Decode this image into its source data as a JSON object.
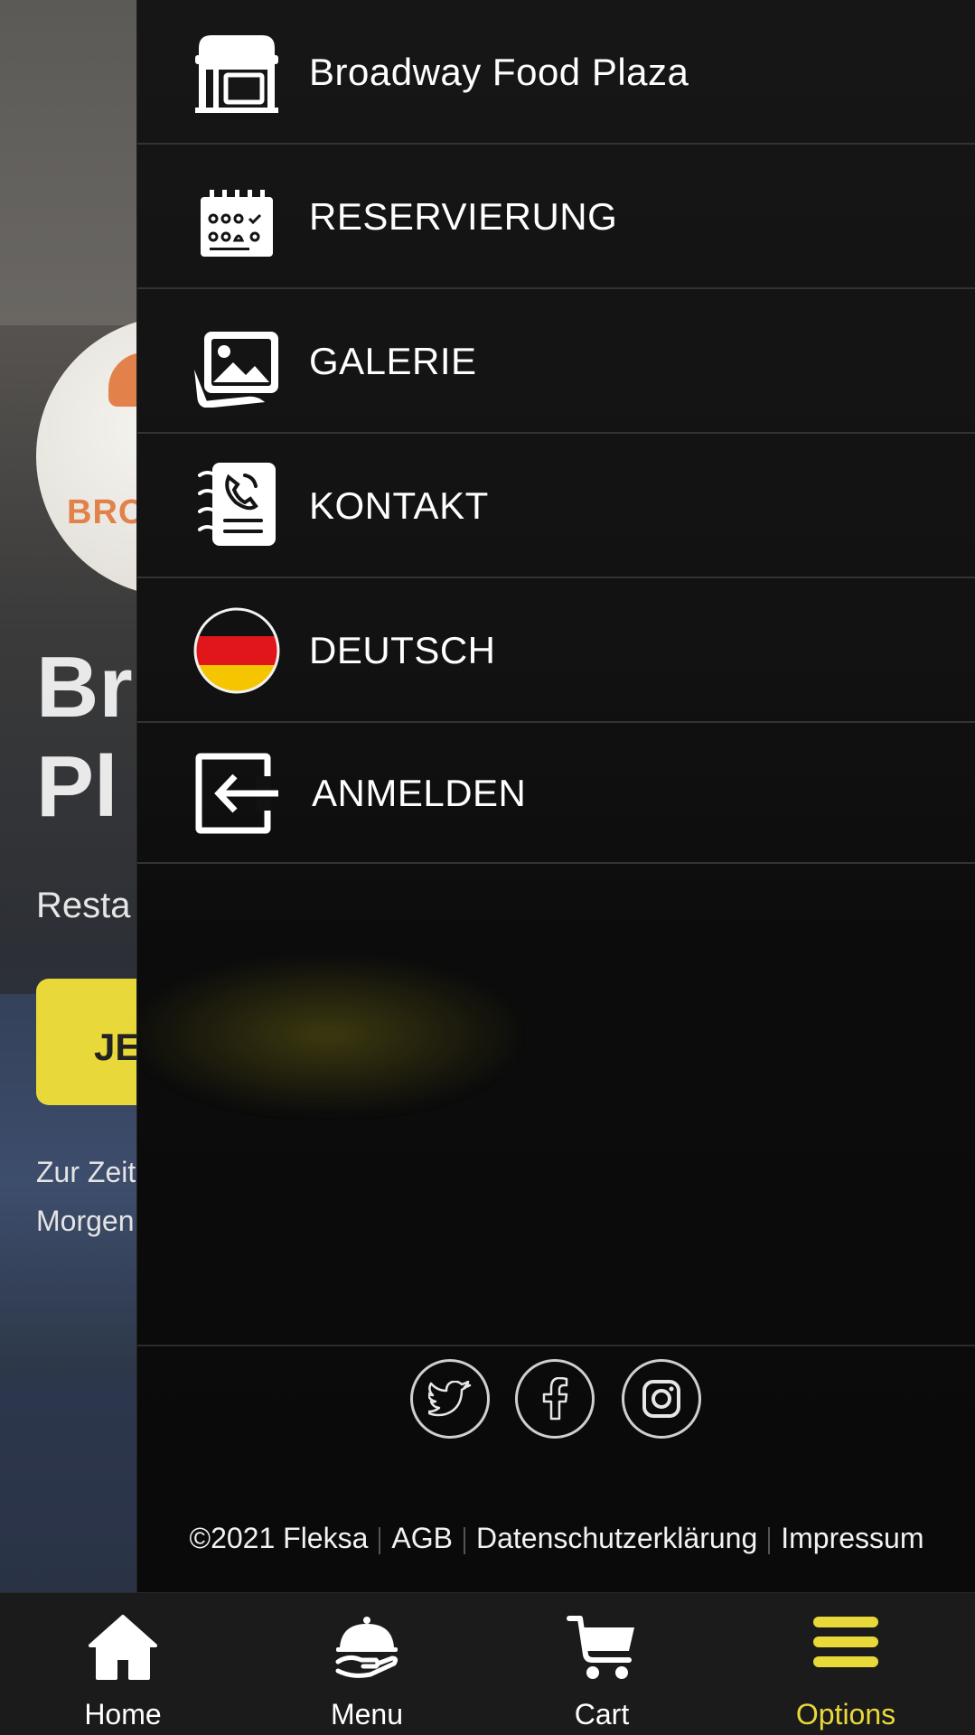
{
  "background_page": {
    "title_line1": "Br",
    "title_line2": "Pl",
    "subtitle": "Resta",
    "logo_text": "BRO",
    "cta_button": "JE",
    "note_line1": "Zur Zeit",
    "note_line2": "Morgen"
  },
  "drawer": {
    "items": [
      {
        "label": "Broadway Food Plaza",
        "icon": "storefront-icon"
      },
      {
        "label": "RESERVIERUNG",
        "icon": "calendar-icon"
      },
      {
        "label": "GALERIE",
        "icon": "gallery-icon"
      },
      {
        "label": "KONTAKT",
        "icon": "contact-book-icon"
      },
      {
        "label": "DEUTSCH",
        "icon": "german-flag-icon"
      },
      {
        "label": "ANMELDEN",
        "icon": "login-icon"
      }
    ],
    "social": [
      "twitter-icon",
      "facebook-icon",
      "instagram-icon"
    ],
    "footer": {
      "copyright": "©2021 Fleksa",
      "agb": "AGB",
      "privacy": "Datenschutzerklärung",
      "imprint": "Impressum"
    }
  },
  "bottom_nav": {
    "items": [
      {
        "label": "Home",
        "icon": "home-icon",
        "active": false
      },
      {
        "label": "Menu",
        "icon": "cloche-icon",
        "active": false
      },
      {
        "label": "Cart",
        "icon": "cart-icon",
        "active": false
      },
      {
        "label": "Options",
        "icon": "hamburger-icon",
        "active": true
      }
    ],
    "active_color": "#e8d83a",
    "inactive_color": "#ffffff"
  },
  "colors": {
    "accent": "#e8d83a",
    "drawer_bg": "#121212",
    "nav_bg": "#1b1b1b"
  }
}
